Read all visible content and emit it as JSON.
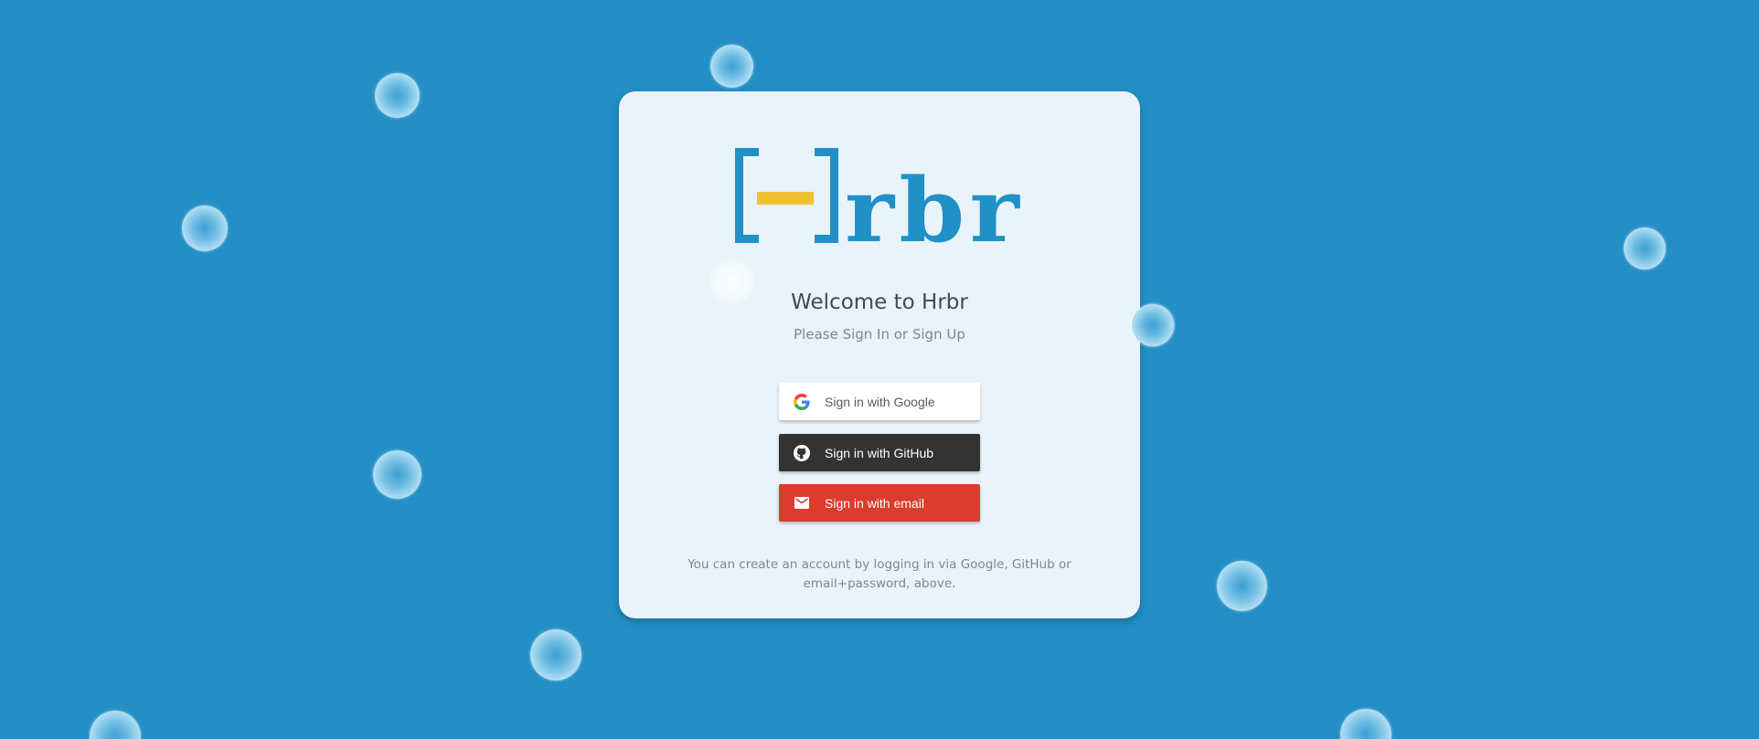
{
  "brand": {
    "name": "Hrbr",
    "logo_letters": "rbr",
    "colors": {
      "primary": "#2190c7",
      "accent": "#f0c233",
      "background": "#238fc6",
      "card": "#e8f4fa"
    }
  },
  "login": {
    "title": "Welcome to Hrbr",
    "subtitle": "Please Sign In or Sign Up",
    "buttons": {
      "google": {
        "label": "Sign in with Google",
        "icon": "google-icon"
      },
      "github": {
        "label": "Sign in with GitHub",
        "icon": "github-icon"
      },
      "email": {
        "label": "Sign in with email",
        "icon": "mail-icon"
      }
    },
    "footnote": "You can create an account by logging in via Google, GitHub or email+password, above."
  }
}
